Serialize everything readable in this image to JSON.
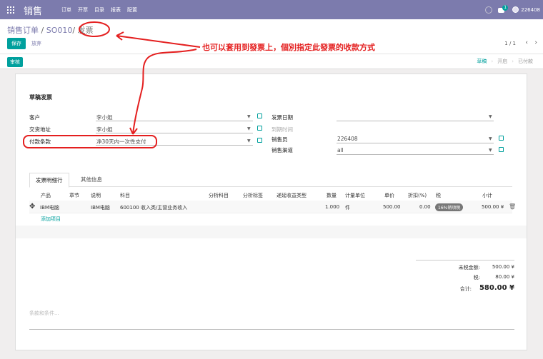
{
  "app": {
    "title": "销售",
    "menu": [
      "订单",
      "开票",
      "目录",
      "报表",
      "配置"
    ],
    "notif_count": "1",
    "user": "226408"
  },
  "breadcrumb": {
    "root": "销售订单",
    "sep": "/",
    "order": "SO010",
    "current": "发票"
  },
  "actions": {
    "save": "保存",
    "discard": "放弃",
    "pager": "1 / 1",
    "prev": "‹",
    "next": "›"
  },
  "status": {
    "approve": "审核",
    "states": [
      "草稿",
      "开启",
      "已付款"
    ]
  },
  "form": {
    "title": "草稿发票",
    "customer_label": "客户",
    "customer": "李小姐",
    "delivery_label": "交货地址",
    "delivery": "李小姐",
    "payment_terms_label": "付款条款",
    "payment_terms": "净30天内一次性支付",
    "invoice_date_label": "发票日期",
    "invoice_date": "",
    "due_date_label": "到期时间",
    "salesperson_label": "销售员",
    "salesperson": "226408",
    "channel_label": "销售渠道",
    "channel": "all"
  },
  "tabs": [
    "发票明细行",
    "其他信息"
  ],
  "table": {
    "headers": [
      "产品",
      "章节",
      "说明",
      "科目",
      "分析科目",
      "分析标签",
      "递延收益类型",
      "数量",
      "计量单位",
      "单价",
      "折扣(%)",
      "税",
      "小计"
    ],
    "row": {
      "product": "IBM电脑",
      "description": "IBM电脑",
      "account": "600100 收入类/主营业务收入",
      "qty": "1.000",
      "uom": "件",
      "price": "500.00",
      "discount": "0.00",
      "tax": "16%销项税",
      "subtotal": "500.00 ¥"
    },
    "add_line": "添加项目"
  },
  "totals": {
    "untaxed_label": "未税金额:",
    "untaxed": "500.00 ¥",
    "tax_label": "税:",
    "tax": "80.00 ¥",
    "total_label": "合计:",
    "total": "580.00 ¥"
  },
  "terms_placeholder": "条款和条件...",
  "annotation": "也可以套用到發票上，個別指定此發票的收款方式",
  "colors": {
    "brand": "#7c7bad",
    "accent": "#00a09d",
    "annotation": "#e41f1f"
  }
}
